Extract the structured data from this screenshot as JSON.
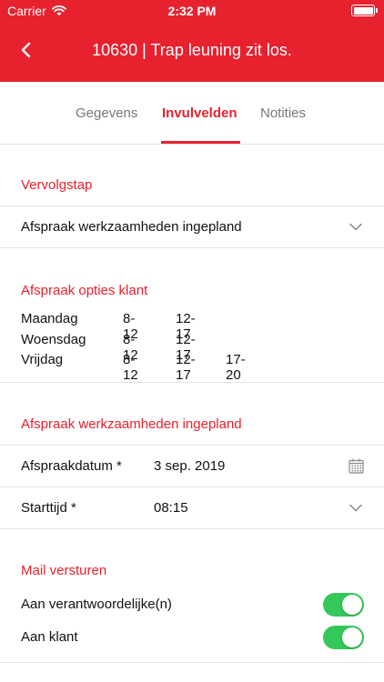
{
  "status_bar": {
    "carrier": "Carrier",
    "time": "2:32 PM"
  },
  "nav": {
    "title": "10630 | Trap leuning zit los."
  },
  "tabs": [
    {
      "label": "Gegevens",
      "active": false
    },
    {
      "label": "Invulvelden",
      "active": true
    },
    {
      "label": "Notities",
      "active": false
    }
  ],
  "vervolgstap": {
    "title": "Vervolgstap",
    "value": "Afspraak werkzaamheden ingepland"
  },
  "opties": {
    "title": "Afspraak opties klant",
    "rows": [
      {
        "day": "Maandag",
        "slots": [
          "8-12",
          "12-17"
        ]
      },
      {
        "day": "Woensdag",
        "slots": [
          "8-12",
          "12-17"
        ]
      },
      {
        "day": "Vrijdag",
        "slots": [
          "8-12",
          "12-17",
          "17-20"
        ]
      }
    ]
  },
  "afspraak": {
    "title": "Afspraak werkzaamheden ingepland",
    "date_label": "Afspraakdatum *",
    "date_value": "3 sep. 2019",
    "time_label": "Starttijd *",
    "time_value": "08:15"
  },
  "mail": {
    "title": "Mail versturen",
    "toggles": [
      {
        "label": "Aan verantwoordelijke(n)",
        "on": true
      },
      {
        "label": "Aan klant",
        "on": true
      }
    ]
  },
  "colors": {
    "accent": "#e8212f",
    "toggle_on": "#34c759",
    "divider": "#e4e4e4"
  },
  "icons": {
    "back": "chevron-left-icon",
    "dropdown": "chevron-down-icon",
    "calendar": "calendar-icon",
    "wifi": "wifi-icon",
    "battery": "battery-icon"
  }
}
